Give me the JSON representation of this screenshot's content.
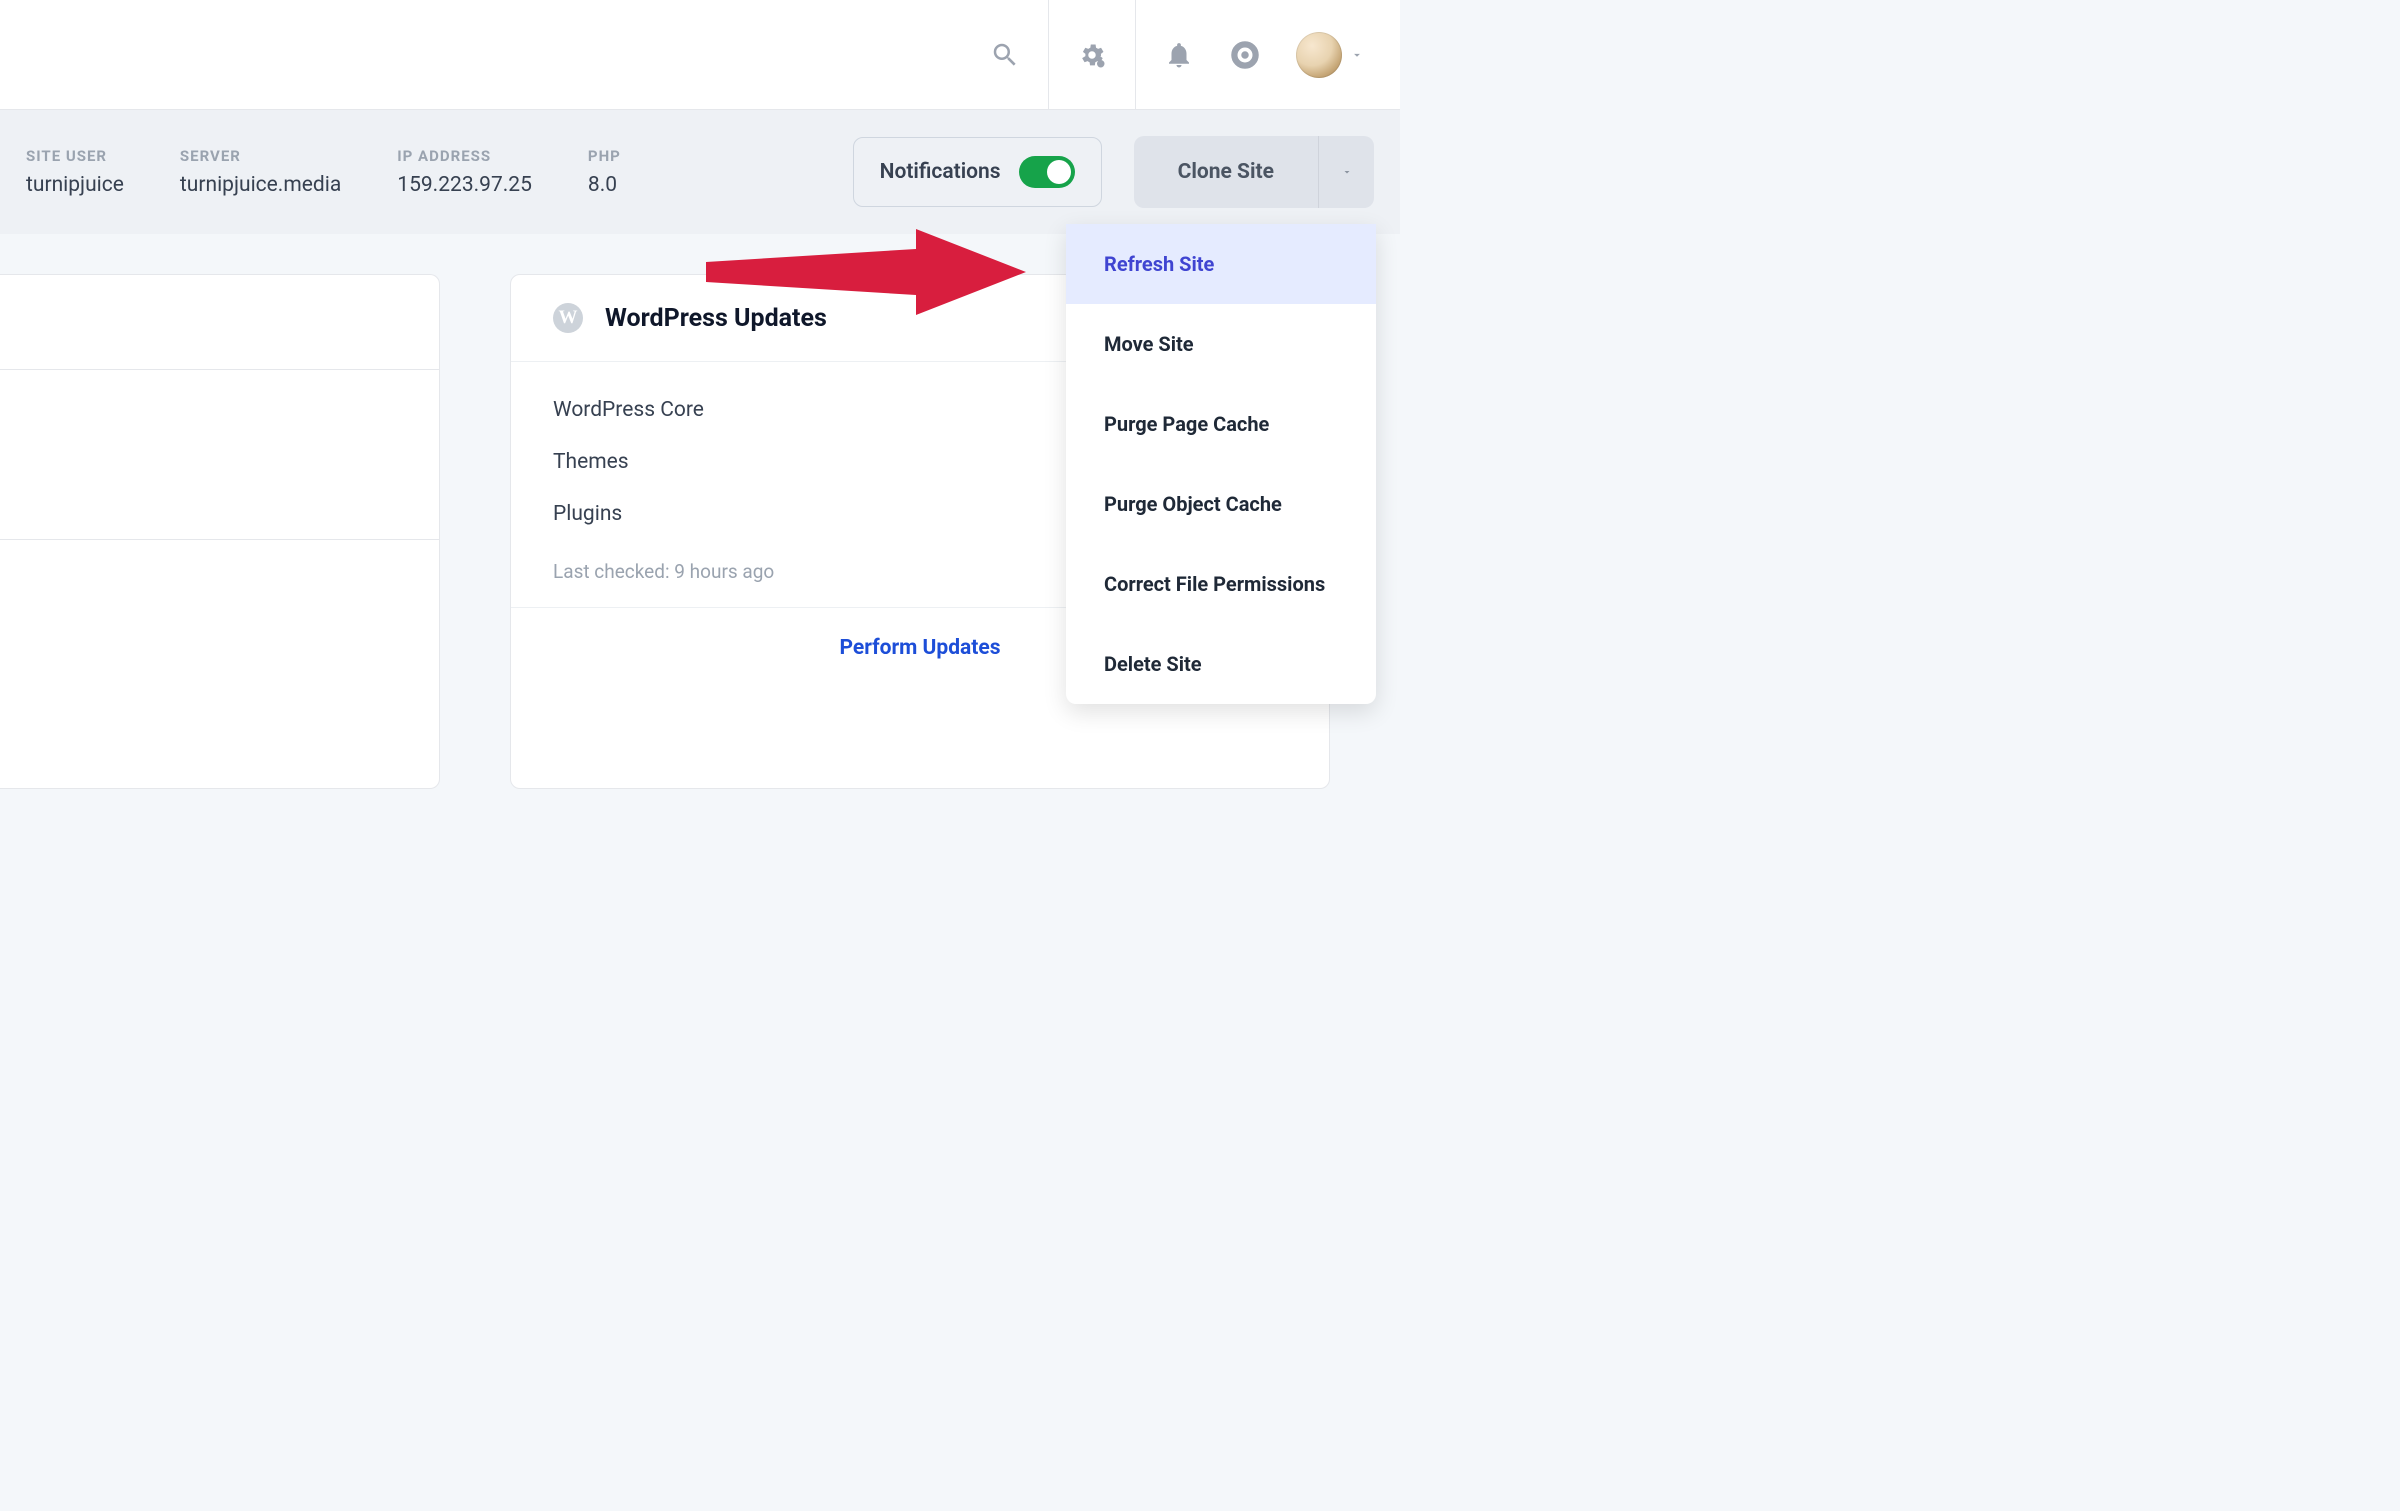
{
  "header": {
    "icons": {
      "search": "search-icon",
      "settings": "gear-icon",
      "bell": "bell-icon",
      "help": "lifebuoy-icon"
    }
  },
  "info": {
    "site_user_label": "SITE USER",
    "site_user_value": "turnipjuice",
    "server_label": "SERVER",
    "server_value": "turnipjuice.media",
    "ip_label": "IP ADDRESS",
    "ip_value": "159.223.97.25",
    "php_label": "PHP",
    "php_value": "8.0",
    "notifications_label": "Notifications",
    "clone_label": "Clone Site"
  },
  "dropdown": {
    "items": [
      "Refresh Site",
      "Move Site",
      "Purge Page Cache",
      "Purge Object Cache",
      "Correct File Permissions",
      "Delete Site"
    ]
  },
  "wp_card": {
    "logo_char": "W",
    "title": "WordPress Updates",
    "rows": [
      "WordPress Core",
      "Themes",
      "Plugins"
    ],
    "last_checked": "Last checked: 9 hours ago",
    "cta": "Perform Updates"
  }
}
